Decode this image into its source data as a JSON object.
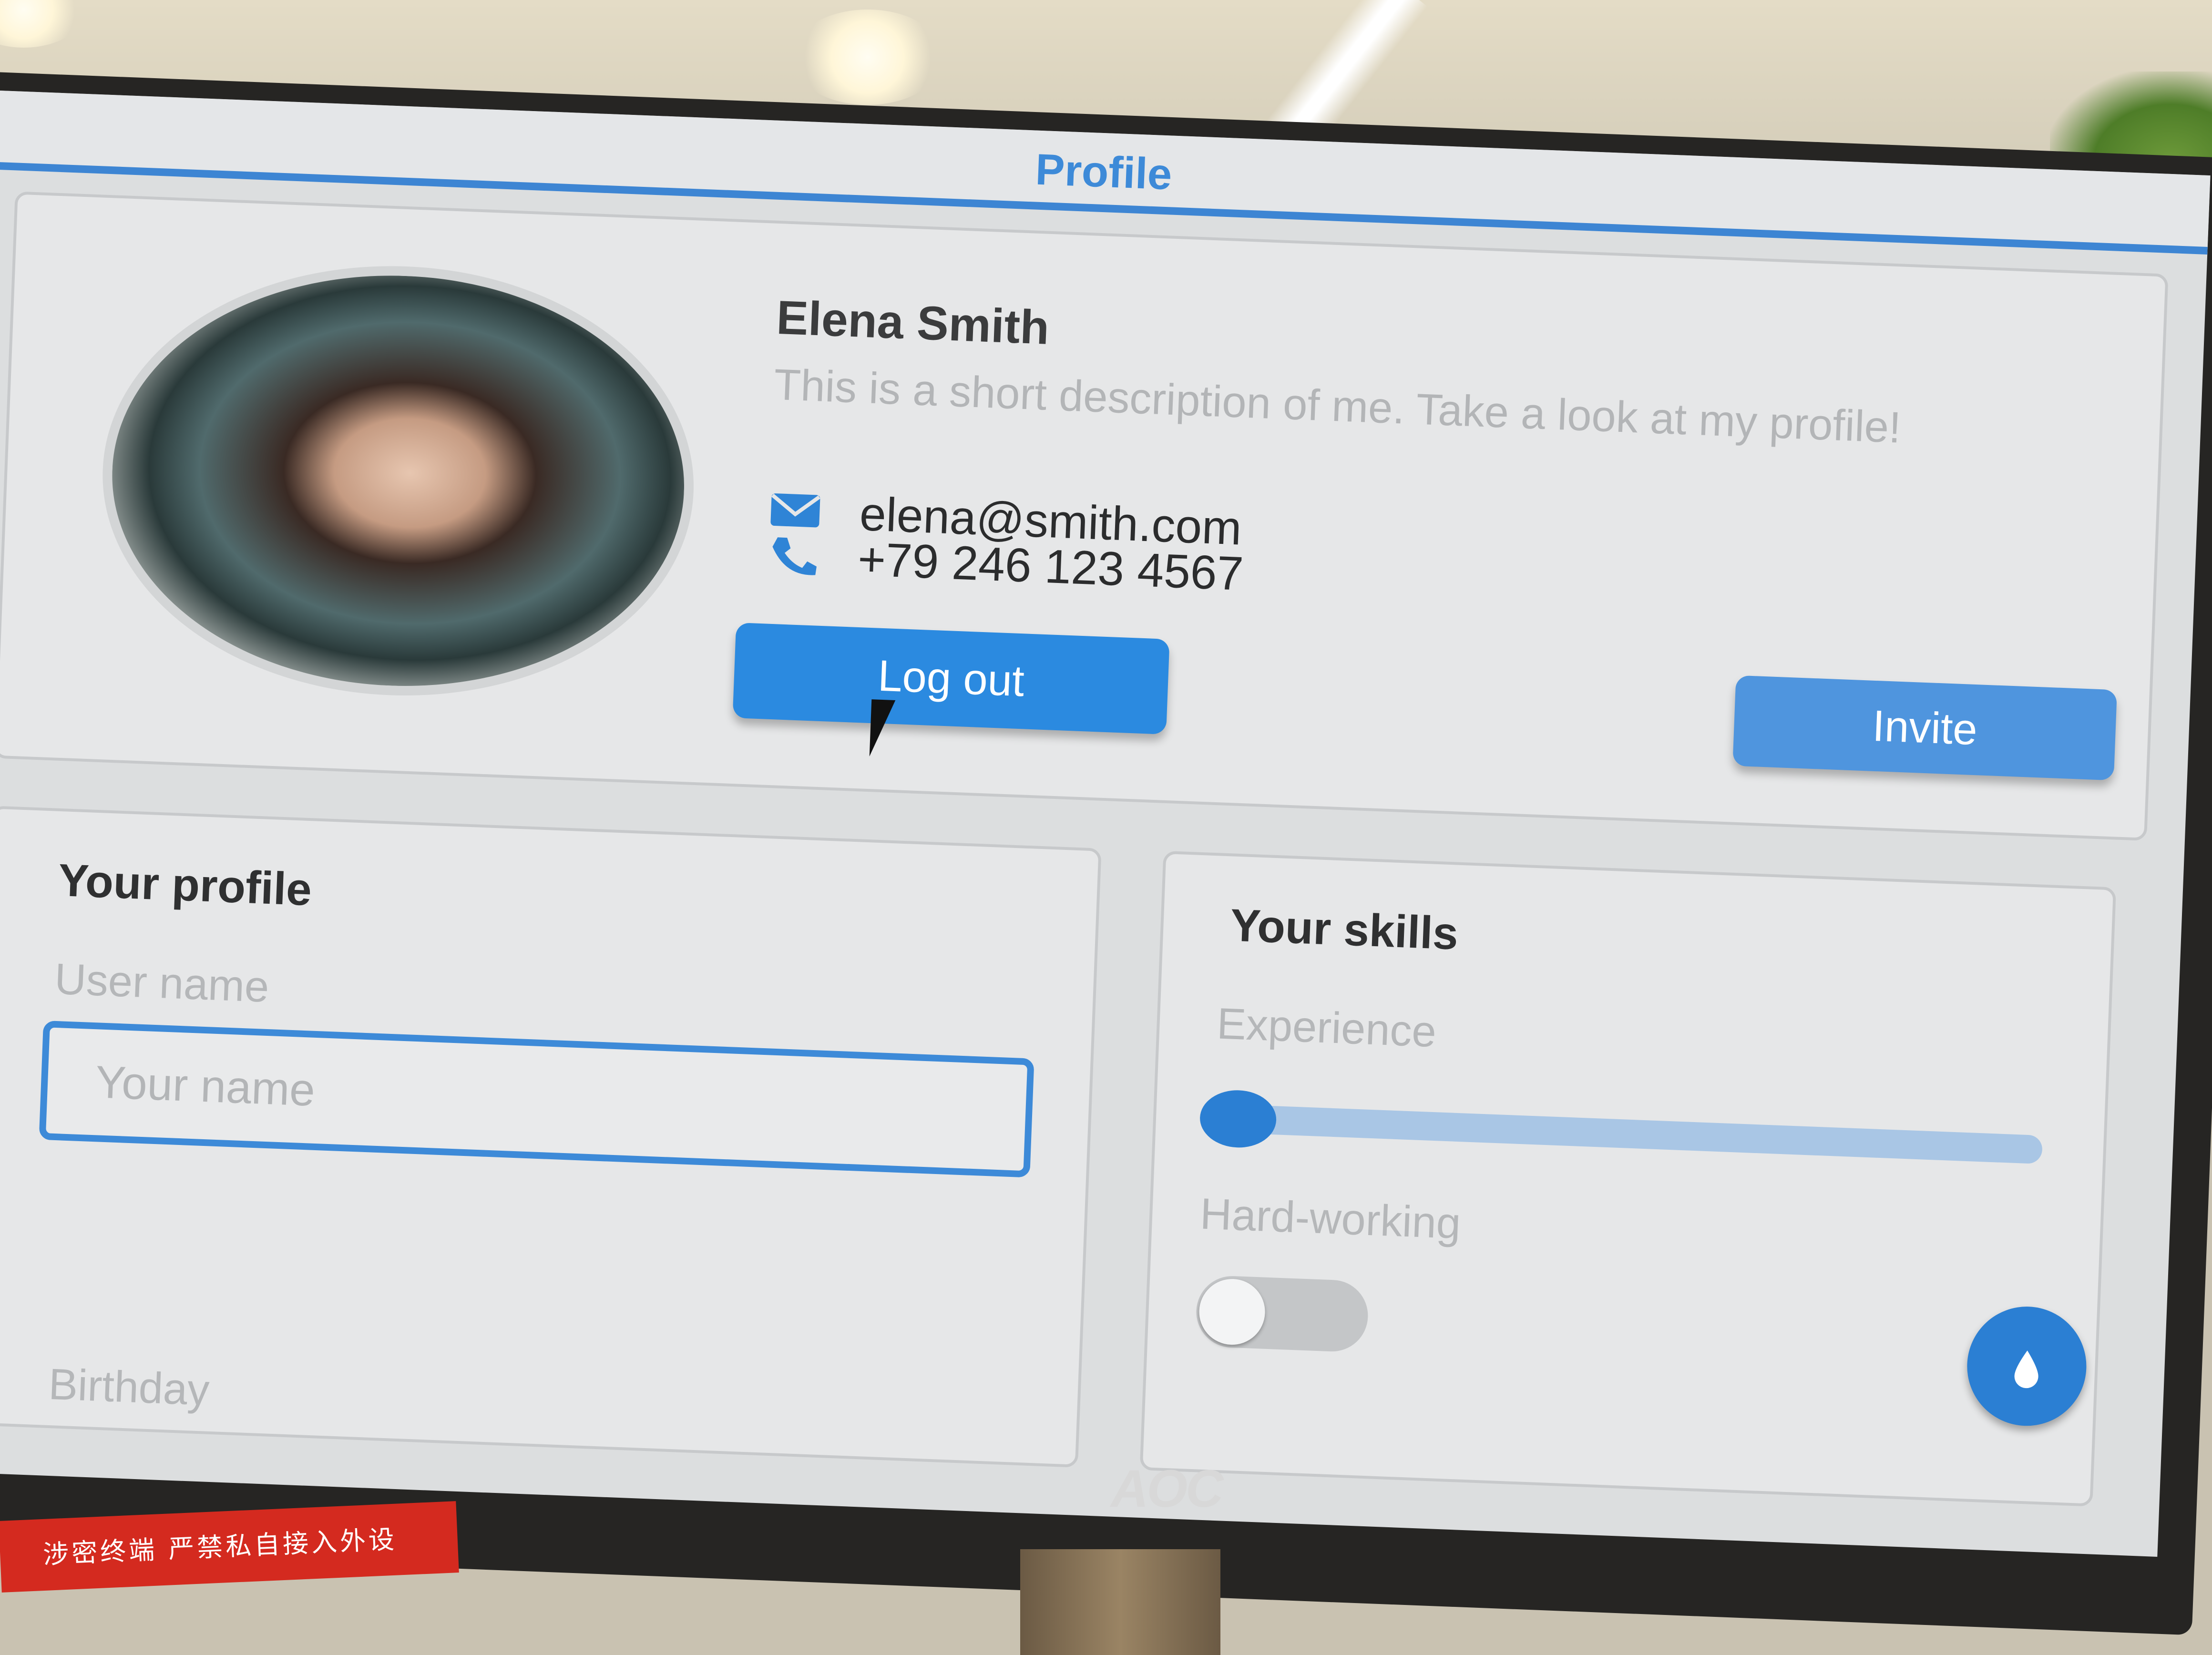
{
  "app": {
    "title": "Profile"
  },
  "user": {
    "name": "Elena Smith",
    "description": "This is a short description of me. Take a look at my profile!",
    "email": "elena@smith.com",
    "phone": "+79 246 123 4567"
  },
  "buttons": {
    "logout": "Log out",
    "invite": "Invite"
  },
  "icons": {
    "email": "envelope-icon",
    "phone": "phone-icon",
    "fab": "water-drop-icon"
  },
  "profile_panel": {
    "title": "Your profile",
    "username_label": "User name",
    "username_placeholder": "Your name",
    "username_value": "",
    "birthday_label": "Birthday"
  },
  "skills_panel": {
    "title": "Your skills",
    "experience_label": "Experience",
    "experience_value": 0.03,
    "hard_working_label": "Hard-working",
    "hard_working_on": false
  },
  "environment": {
    "monitor_brand": "AOC",
    "sticker_text": "涉密终端 严禁私自接入外设"
  },
  "colors": {
    "accent": "#3d8ad8",
    "button": "#2b8ae0",
    "sticker": "#d42a1f"
  }
}
